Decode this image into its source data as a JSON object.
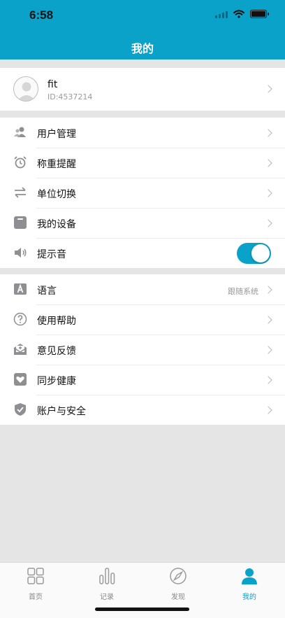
{
  "status": {
    "time": "6:58"
  },
  "header": {
    "title": "我的"
  },
  "profile": {
    "name": "fit",
    "id": "ID:4537214"
  },
  "section1": [
    {
      "label": "用户管理",
      "icon": "users-icon"
    },
    {
      "label": "称重提醒",
      "icon": "alarm-clock-icon"
    },
    {
      "label": "单位切换",
      "icon": "swap-arrows-icon"
    },
    {
      "label": "我的设备",
      "icon": "device-icon"
    },
    {
      "label": "提示音",
      "icon": "speaker-icon",
      "toggle": true
    }
  ],
  "section2": [
    {
      "label": "语言",
      "icon": "language-icon",
      "extra": "跟随系统"
    },
    {
      "label": "使用帮助",
      "icon": "help-icon"
    },
    {
      "label": "意见反馈",
      "icon": "feedback-mail-icon"
    },
    {
      "label": "同步健康",
      "icon": "health-heart-icon"
    },
    {
      "label": "账户与安全",
      "icon": "shield-check-icon"
    }
  ],
  "tabs": [
    {
      "label": "首页",
      "icon": "grid-home-icon",
      "active": false
    },
    {
      "label": "记录",
      "icon": "bar-chart-icon",
      "active": false
    },
    {
      "label": "发现",
      "icon": "compass-icon",
      "active": false
    },
    {
      "label": "我的",
      "icon": "person-icon",
      "active": true
    }
  ],
  "colors": {
    "accent": "#0aa2c9",
    "background": "#e5e5e5"
  }
}
